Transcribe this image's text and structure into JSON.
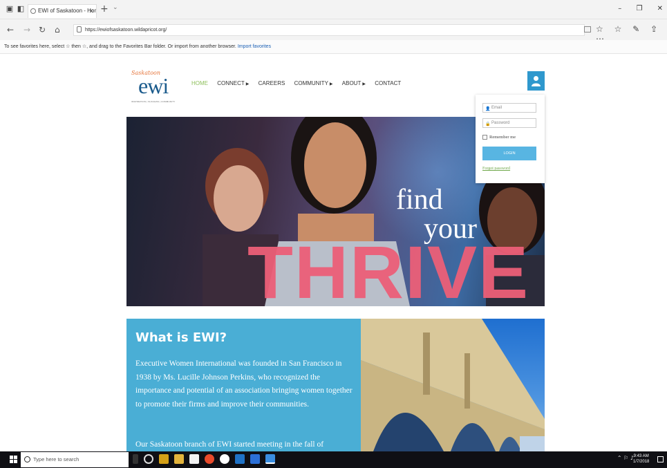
{
  "browser": {
    "tab_title": "EWI of Saskatoon - Hon",
    "url": "https://ewiofsaskatoon.wildapricot.org/",
    "favorites_hint": "To see favorites here, select ☆ then ☆, and drag to the Favorites Bar folder. Or import from another browser.",
    "import_link": "Import favorites"
  },
  "site": {
    "logo_script": "Saskatoon",
    "logo_main": "ewi",
    "logo_tag": "INSPIRATION | SUCCESS | COMMUNITY",
    "nav": [
      {
        "label": "HOME",
        "active": true
      },
      {
        "label": "CONNECT",
        "dropdown": true
      },
      {
        "label": "CAREERS"
      },
      {
        "label": "COMMUNITY",
        "dropdown": true
      },
      {
        "label": "ABOUT",
        "dropdown": true
      },
      {
        "label": "CONTACT"
      }
    ]
  },
  "login": {
    "email_placeholder": "Email",
    "password_placeholder": "Password",
    "remember_label": "Remember me",
    "login_button": "LOGIN",
    "forgot_link": "Forgot password"
  },
  "hero": {
    "line1": "find",
    "line2": "your",
    "line3": "THRIVE"
  },
  "info": {
    "heading": "What is EWI?",
    "paragraph1": "Executive Women International was founded in San Francisco in 1938 by Ms. Lucille Johnson Perkins, who recognized the importance and potential of an association bringing women together to promote their firms and improve their communities.",
    "paragraph2": "Our Saskatoon branch of EWI started meeting in the fall of"
  },
  "taskbar": {
    "search_placeholder": "Type here to search",
    "time": "9:43 AM",
    "date": "1/7/2018"
  },
  "colors": {
    "accent": "#4aaed5",
    "thrive": "#ec5f78",
    "active_nav": "#8dbf5a",
    "logo_blue": "#1b5b8c"
  }
}
